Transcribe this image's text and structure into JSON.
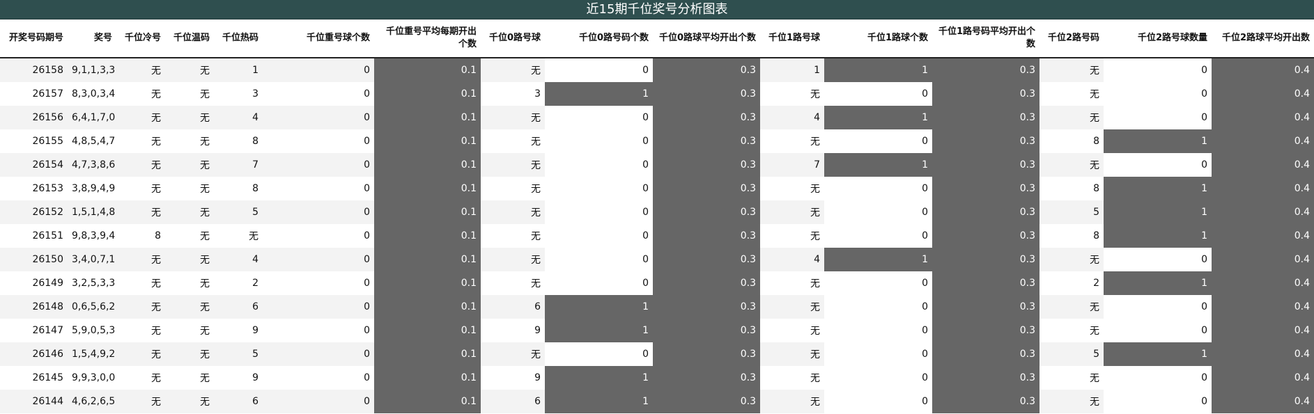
{
  "title": "近15期千位奖号分析图表",
  "headers": [
    "开奖号码期号",
    "奖号",
    "千位冷号",
    "千位温码",
    "千位热码",
    "千位重号球个数",
    "千位重号平均每期开出个数",
    "千位0路号球",
    "千位0路号码个数",
    "千位0路球平均开出个数",
    "千位1路号球",
    "千位1路球个数",
    "千位1路号码平均开出个数",
    "千位2路号码",
    "千位2路号球数量",
    "千位2路球平均开出数"
  ],
  "rows": [
    [
      "26158",
      "9,1,1,3,3",
      "无",
      "无",
      "1",
      "0",
      "0.1",
      "无",
      "0",
      "0.3",
      "1",
      "1",
      "0.3",
      "无",
      "0",
      "0.4"
    ],
    [
      "26157",
      "8,3,0,3,4",
      "无",
      "无",
      "3",
      "0",
      "0.1",
      "3",
      "1",
      "0.3",
      "无",
      "0",
      "0.3",
      "无",
      "0",
      "0.4"
    ],
    [
      "26156",
      "6,4,1,7,0",
      "无",
      "无",
      "4",
      "0",
      "0.1",
      "无",
      "0",
      "0.3",
      "4",
      "1",
      "0.3",
      "无",
      "0",
      "0.4"
    ],
    [
      "26155",
      "4,8,5,4,7",
      "无",
      "无",
      "8",
      "0",
      "0.1",
      "无",
      "0",
      "0.3",
      "无",
      "0",
      "0.3",
      "8",
      "1",
      "0.4"
    ],
    [
      "26154",
      "4,7,3,8,6",
      "无",
      "无",
      "7",
      "0",
      "0.1",
      "无",
      "0",
      "0.3",
      "7",
      "1",
      "0.3",
      "无",
      "0",
      "0.4"
    ],
    [
      "26153",
      "3,8,9,4,9",
      "无",
      "无",
      "8",
      "0",
      "0.1",
      "无",
      "0",
      "0.3",
      "无",
      "0",
      "0.3",
      "8",
      "1",
      "0.4"
    ],
    [
      "26152",
      "1,5,1,4,8",
      "无",
      "无",
      "5",
      "0",
      "0.1",
      "无",
      "0",
      "0.3",
      "无",
      "0",
      "0.3",
      "5",
      "1",
      "0.4"
    ],
    [
      "26151",
      "9,8,3,9,4",
      "8",
      "无",
      "无",
      "0",
      "0.1",
      "无",
      "0",
      "0.3",
      "无",
      "0",
      "0.3",
      "8",
      "1",
      "0.4"
    ],
    [
      "26150",
      "3,4,0,7,1",
      "无",
      "无",
      "4",
      "0",
      "0.1",
      "无",
      "0",
      "0.3",
      "4",
      "1",
      "0.3",
      "无",
      "0",
      "0.4"
    ],
    [
      "26149",
      "3,2,5,3,3",
      "无",
      "无",
      "2",
      "0",
      "0.1",
      "无",
      "0",
      "0.3",
      "无",
      "0",
      "0.3",
      "2",
      "1",
      "0.4"
    ],
    [
      "26148",
      "0,6,5,6,2",
      "无",
      "无",
      "6",
      "0",
      "0.1",
      "6",
      "1",
      "0.3",
      "无",
      "0",
      "0.3",
      "无",
      "0",
      "0.4"
    ],
    [
      "26147",
      "5,9,0,5,3",
      "无",
      "无",
      "9",
      "0",
      "0.1",
      "9",
      "1",
      "0.3",
      "无",
      "0",
      "0.3",
      "无",
      "0",
      "0.4"
    ],
    [
      "26146",
      "1,5,4,9,2",
      "无",
      "无",
      "5",
      "0",
      "0.1",
      "无",
      "0",
      "0.3",
      "无",
      "0",
      "0.3",
      "5",
      "1",
      "0.4"
    ],
    [
      "26145",
      "9,9,3,0,0",
      "无",
      "无",
      "9",
      "0",
      "0.1",
      "9",
      "1",
      "0.3",
      "无",
      "0",
      "0.3",
      "无",
      "0",
      "0.4"
    ],
    [
      "26144",
      "4,6,2,6,5",
      "无",
      "无",
      "6",
      "0",
      "0.1",
      "6",
      "1",
      "0.3",
      "无",
      "0",
      "0.3",
      "无",
      "0",
      "0.4"
    ]
  ],
  "colors": {
    "title_bg": "#2f4f4f",
    "dark_cell": "#666666",
    "alt_row": "#f3f3f3"
  }
}
